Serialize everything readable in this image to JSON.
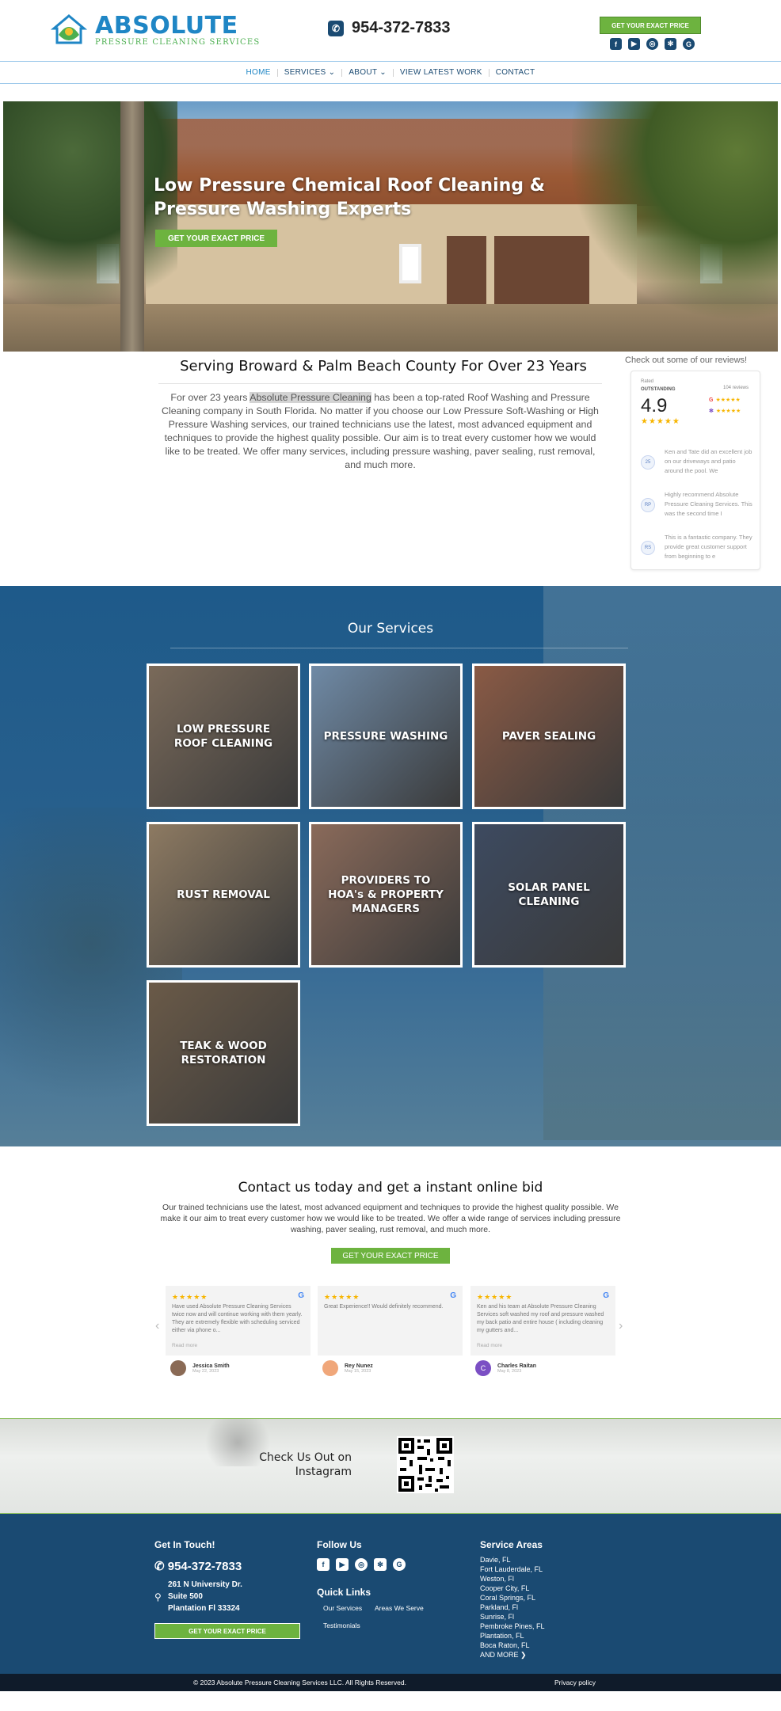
{
  "header": {
    "logo_name": "ABSOLUTE",
    "logo_sub": "PRESSURE CLEANING SERVICES",
    "phone": "954-372-7833",
    "cta": "GET YOUR EXACT PRICE",
    "social": [
      "facebook-icon",
      "youtube-icon",
      "instagram-icon",
      "yelp-icon",
      "google-icon"
    ]
  },
  "nav": {
    "items": [
      "HOME",
      "SERVICES",
      "ABOUT",
      "VIEW LATEST WORK",
      "CONTACT"
    ]
  },
  "hero": {
    "title": "Low Pressure Chemical Roof Cleaning & Pressure Washing Experts",
    "cta": "GET YOUR EXACT PRICE"
  },
  "about": {
    "title": "Serving Broward & Palm Beach County For Over 23 Years",
    "text_before": "For over 23 years ",
    "highlight": "Absolute Pressure Cleaning",
    "text_after": " has been a top-rated Roof Washing and Pressure Cleaning company in South Florida. No matter if you choose our Low Pressure Soft-Washing or High Pressure Washing services, our trained technicians use the latest, most advanced equipment and techniques to provide the highest quality possible. Our aim is to treat every customer how we would like to be treated. We offer many services, including pressure washing, paver sealing, rust removal, and much more."
  },
  "reviews_widget": {
    "heading": "Check out some of our reviews!",
    "rated": "Rated",
    "label": "OUTSTANDING",
    "score": "4.9",
    "stars": "★★★★★",
    "count": "104 reviews",
    "source_stars": "★★★★★",
    "items": [
      {
        "initials": "25",
        "text": "Ken and Tate did an excellent job on our driveways and patio around the pool. We"
      },
      {
        "initials": "RP",
        "text": "Highly recommend Absolute Pressure Cleaning Services. This was the second time I"
      },
      {
        "initials": "RS",
        "text": "This is a fantastic company. They provide great customer support from beginning to e"
      }
    ]
  },
  "services": {
    "title": "Our Services",
    "tiles": [
      {
        "label": "LOW PRESSURE ROOF CLEANING",
        "color": "#7a6a5a"
      },
      {
        "label": "PRESSURE WASHING",
        "color": "#6f8aa6"
      },
      {
        "label": "PAVER SEALING",
        "color": "#8a5a45"
      },
      {
        "label": "RUST REMOVAL",
        "color": "#8d7a62"
      },
      {
        "label": "PROVIDERS TO HOA's & PROPERTY MANAGERS",
        "color": "#8a6a5a"
      },
      {
        "label": "SOLAR PANEL CLEANING",
        "color": "#3d4a60"
      },
      {
        "label": "TEAK & WOOD RESTORATION",
        "color": "#6a5a48"
      }
    ]
  },
  "contact": {
    "title": "Contact us today and get a instant online bid",
    "text": "Our trained technicians use the latest, most advanced equipment and techniques to provide the highest quality possible. We make it our aim to treat every customer how we would like to be treated. We offer a wide range of services including pressure washing, paver sealing, rust removal, and much more.",
    "cta": "GET YOUR EXACT PRICE",
    "read_more": "Read more",
    "cards": [
      {
        "stars": "★★★★★",
        "text": "Have used Absolute Pressure Cleaning Services twice now and will continue working with them yearly. They are extremely flexible with scheduling serviced either via phone o...",
        "name": "Jessica Smith",
        "date": "May 22, 2023",
        "avatar_color": "#8a6a55",
        "initial": ""
      },
      {
        "stars": "★★★★★",
        "text": "Great Experience!! Would definitely recommend.",
        "name": "Rey Nunez",
        "date": "May 15, 2023",
        "avatar_color": "#f0a77a",
        "initial": ""
      },
      {
        "stars": "★★★★★",
        "text": "Ken and his team at Absolute Pressure Cleaning Services soft washed my roof and pressure washed my back patio and entire house ( including cleaning my gutters and...",
        "name": "Charles Raitan",
        "date": "May 8, 2023",
        "avatar_color": "#7b4fc4",
        "initial": "C"
      }
    ]
  },
  "instagram": {
    "text": "Check Us Out on Instagram"
  },
  "footer": {
    "touch_title": "Get In Touch!",
    "phone": "954-372-7833",
    "address": [
      "261 N University Dr.",
      "Suite 500",
      "Plantation Fl 33324"
    ],
    "cta": "GET YOUR EXACT PRICE",
    "follow_title": "Follow Us",
    "quick_title": "Quick Links",
    "quick_links": [
      "Our Services",
      "Areas We Serve",
      "Testimonials"
    ],
    "areas_title": "Service Areas",
    "areas": [
      "Davie, FL",
      "Fort Lauderdale, FL",
      "Weston, Fl",
      "Cooper City, FL",
      "Coral Springs, FL",
      "Parkland, Fl",
      "Sunrise, Fl",
      "Pembroke Pines, FL",
      "Plantation, FL",
      "Boca Raton, FL",
      "AND MORE ❯"
    ],
    "copyright": "© 2023 Absolute Pressure Cleaning Services LLC. All Rights Reserved.",
    "privacy": "Privacy policy"
  }
}
